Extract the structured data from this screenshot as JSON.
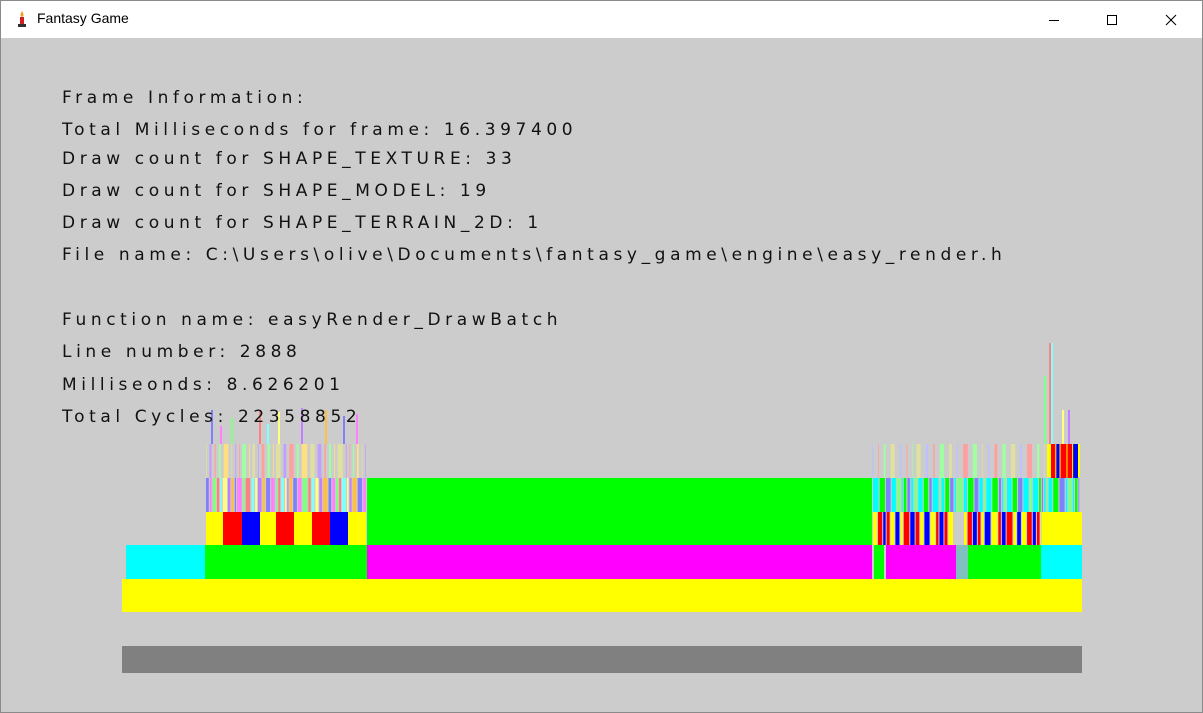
{
  "window": {
    "title": "Fantasy Game",
    "icon": "candle-app-icon",
    "controls": {
      "minimize": "minimize-icon",
      "maximize": "maximize-icon",
      "close": "close-icon"
    }
  },
  "frame_info": {
    "heading": "Frame Information:",
    "total_ms": "Total Milliseconds for frame: 16.397400",
    "draw_texture": "Draw count for SHAPE_TEXTURE: 33",
    "draw_model": "Draw count for SHAPE_MODEL: 19",
    "draw_terrain": "Draw count for SHAPE_TERRAIN_2D: 1",
    "file_name": "File name: C:\\Users\\olive\\Documents\\fantasy_game\\engine\\easy_render.h"
  },
  "selected_block": {
    "function_name": "Function name: easyRender_DrawBatch",
    "line_number": "Line number: 2888",
    "milliseconds": "Milliseonds: 8.626201",
    "total_cycles": "Total Cycles: 22358852"
  },
  "colors": {
    "background": "#cccccc",
    "frame_bar": "#808080",
    "yellow": "#ffff00",
    "cyan": "#00ffff",
    "green": "#00ff00",
    "magenta": "#ff00ff",
    "red": "#ff0000",
    "blue": "#0000ff"
  }
}
